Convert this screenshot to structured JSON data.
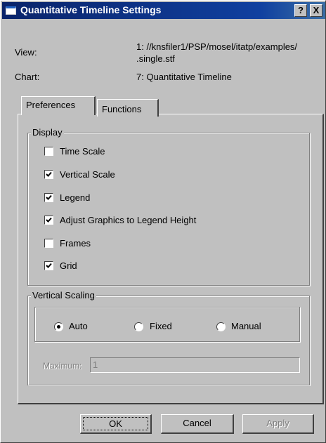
{
  "window": {
    "title": "Quantitative Timeline Settings",
    "help_btn": "?",
    "close_btn": "X"
  },
  "info": {
    "view_label": "View:",
    "view_value_line1": "1: //knsfiler1/PSP/mosel/itatp/examples/",
    "view_value_line2": ".single.stf",
    "chart_label": "Chart:",
    "chart_value": "7: Quantitative Timeline"
  },
  "tabs": [
    {
      "label": "Preferences",
      "selected": true
    },
    {
      "label": "Functions",
      "selected": false
    }
  ],
  "display": {
    "title": "Display",
    "items": [
      {
        "label": "Time Scale",
        "checked": false
      },
      {
        "label": "Vertical Scale",
        "checked": true
      },
      {
        "label": "Legend",
        "checked": true
      },
      {
        "label": "Adjust Graphics to Legend Height",
        "checked": true
      },
      {
        "label": "Frames",
        "checked": false
      },
      {
        "label": "Grid",
        "checked": true
      }
    ]
  },
  "vertical_scaling": {
    "title": "Vertical Scaling",
    "options": [
      {
        "label": "Auto",
        "selected": true
      },
      {
        "label": "Fixed",
        "selected": false
      },
      {
        "label": "Manual",
        "selected": false
      }
    ],
    "maximum_label": "Maximum:",
    "maximum_value": "1"
  },
  "buttons": {
    "ok": "OK",
    "cancel": "Cancel",
    "apply": "Apply"
  }
}
